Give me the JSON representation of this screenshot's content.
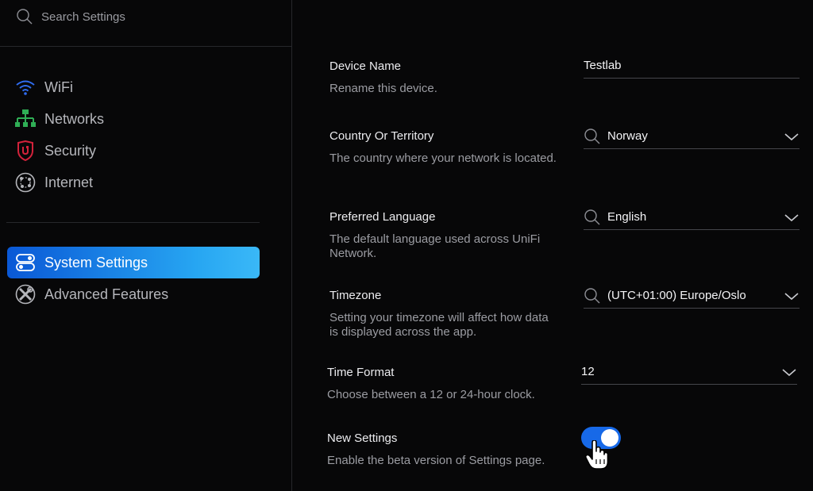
{
  "search": {
    "placeholder": "Search Settings"
  },
  "sidebar": {
    "items": [
      {
        "label": "WiFi",
        "icon": "wifi-icon",
        "active": false
      },
      {
        "label": "Networks",
        "icon": "network-topology-icon",
        "active": false
      },
      {
        "label": "Security",
        "icon": "shield-icon",
        "active": false
      },
      {
        "label": "Internet",
        "icon": "globe-icon",
        "active": false
      },
      {
        "label": "System Settings",
        "icon": "toggle-switches-icon",
        "active": true
      },
      {
        "label": "Advanced Features",
        "icon": "tools-icon",
        "active": false
      }
    ]
  },
  "settings": {
    "device_name": {
      "title": "Device Name",
      "desc": "Rename this device.",
      "value": "Testlab"
    },
    "country": {
      "title": "Country Or Territory",
      "desc": "The country where your network is located.",
      "value": "Norway"
    },
    "language": {
      "title": "Preferred Language",
      "desc": "The default language used across UniFi Network.",
      "value": "English"
    },
    "timezone": {
      "title": "Timezone",
      "desc": "Setting your timezone will affect how data is displayed across the app.",
      "value": "(UTC+01:00) Europe/Oslo"
    },
    "time_format": {
      "title": "Time Format",
      "desc": "Choose between a 12 or 24-hour clock.",
      "value": "12"
    },
    "new_settings": {
      "title": "New Settings",
      "desc": "Enable the beta version of Settings page.",
      "enabled": true
    }
  },
  "colors": {
    "accent": "#1769e8",
    "active_gradient_end": "#3ab8f7",
    "security": "#d3223b",
    "networks": "#2fae55",
    "wifi": "#2f6cf0"
  }
}
